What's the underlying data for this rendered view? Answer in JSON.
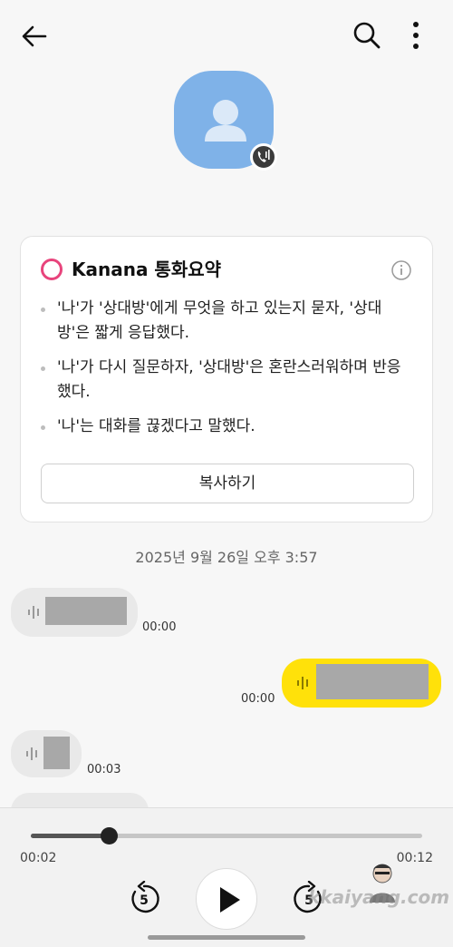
{
  "header": {
    "back_icon": "arrow-left-icon",
    "search_icon": "search-icon",
    "more_icon": "more-vertical-icon"
  },
  "contact": {
    "avatar_icon": "person-icon",
    "badge_icon": "call-recording-icon",
    "avatar_color": "#7fb2e8"
  },
  "summary": {
    "title": "Kanana 통화요약",
    "info_icon": "info-icon",
    "items": [
      "'나'가 '상대방'에게 무엇을 하고 있는지 묻자, '상대방'은 짧게 응답했다.",
      "'나'가 다시 질문하자, '상대방'은 혼란스러워하며 반응했다.",
      "'나'는 대화를 끊겠다고 말했다."
    ],
    "copy_label": "복사하기",
    "accent": "#e8447c"
  },
  "conversation": {
    "date": "2025년 9월 26일 오후 3:57",
    "messages": [
      {
        "side": "them",
        "time": "00:00"
      },
      {
        "side": "me",
        "time": "00:00"
      },
      {
        "side": "them",
        "time": "00:03"
      },
      {
        "side": "them",
        "time": ""
      }
    ],
    "me_color": "#ffe10a"
  },
  "player": {
    "current": "00:02",
    "total": "00:12",
    "progress": 0.2,
    "rewind_label": "5",
    "forward_label": "5",
    "play_icon": "play-icon"
  },
  "watermark": "kkaiyang.com"
}
